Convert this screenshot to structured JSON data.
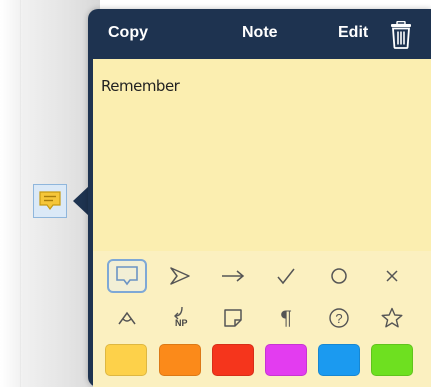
{
  "header": {
    "copy_label": "Copy",
    "title": "Note",
    "edit_label": "Edit",
    "trash_icon": "trash-icon"
  },
  "note": {
    "text": "Remember"
  },
  "icons": [
    {
      "name": "comment-icon",
      "selected": true
    },
    {
      "name": "send-arrow-icon",
      "selected": false
    },
    {
      "name": "right-arrow-icon",
      "selected": false
    },
    {
      "name": "checkmark-icon",
      "selected": false
    },
    {
      "name": "circle-icon",
      "selected": false
    },
    {
      "name": "cross-icon",
      "selected": false
    },
    {
      "name": "insert-caret-icon",
      "selected": false
    },
    {
      "name": "new-paragraph-icon",
      "selected": false,
      "label": "NP"
    },
    {
      "name": "sticky-note-icon",
      "selected": false
    },
    {
      "name": "pilcrow-icon",
      "selected": false,
      "glyph": "¶"
    },
    {
      "name": "help-icon",
      "selected": false,
      "glyph": "?"
    },
    {
      "name": "star-icon",
      "selected": false
    }
  ],
  "colors": [
    "#fdd14a",
    "#fb8a1a",
    "#f5351c",
    "#e33cf0",
    "#1b9af0",
    "#6ee020"
  ],
  "theme": {
    "popover_bg": "#1e3350",
    "note_bg": "#fbeeb0",
    "selection_border": "#7ea8d6"
  }
}
